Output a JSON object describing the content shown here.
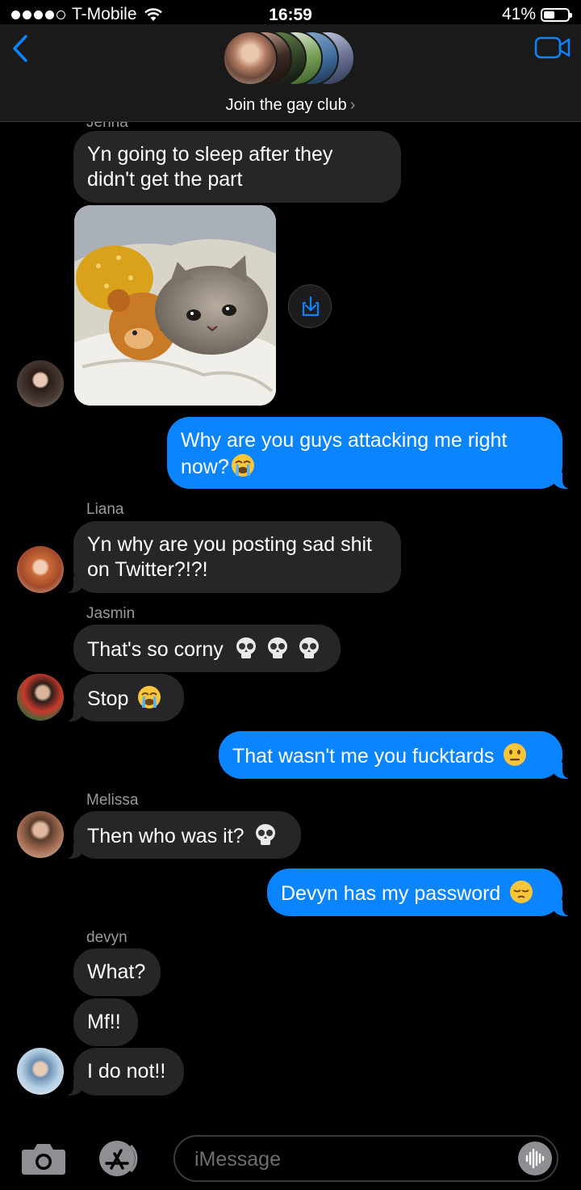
{
  "status_bar": {
    "carrier": "T-Mobile",
    "time": "16:59",
    "battery": "41%",
    "battery_level": 0.41
  },
  "header": {
    "group_name": "Join the gay club",
    "chevron": "›"
  },
  "messages": [
    {
      "sender_label": "Jenna"
    },
    {
      "text": "Yn going to sleep after they"
    },
    {
      "text": "didn't get the part"
    },
    {
      "attachment": "crying-cat-with-teddy-bear-photo"
    },
    {
      "text": "Why are you guys attacking me right"
    },
    {
      "text": "now?"
    },
    {
      "sender_label": "Liana"
    },
    {
      "text": "Yn why are you posting sad shit"
    },
    {
      "text": "on Twitter?!?!"
    },
    {
      "sender_label": "Jasmin"
    },
    {
      "text": "That's so corny"
    },
    {
      "text": "Stop"
    },
    {
      "text": "That wasn't me you fucktards"
    },
    {
      "sender_label": "Melissa"
    },
    {
      "text": "Then who was it?"
    },
    {
      "text": "Devyn has my password"
    },
    {
      "sender_label": "devyn"
    },
    {
      "text": "What?"
    },
    {
      "text": "Mf!!"
    },
    {
      "text": "I do not!!"
    }
  ],
  "composer": {
    "placeholder": "iMessage"
  },
  "colors": {
    "outgoing": "#0a84ff",
    "incoming": "#262628",
    "accent": "#0a84ff"
  }
}
